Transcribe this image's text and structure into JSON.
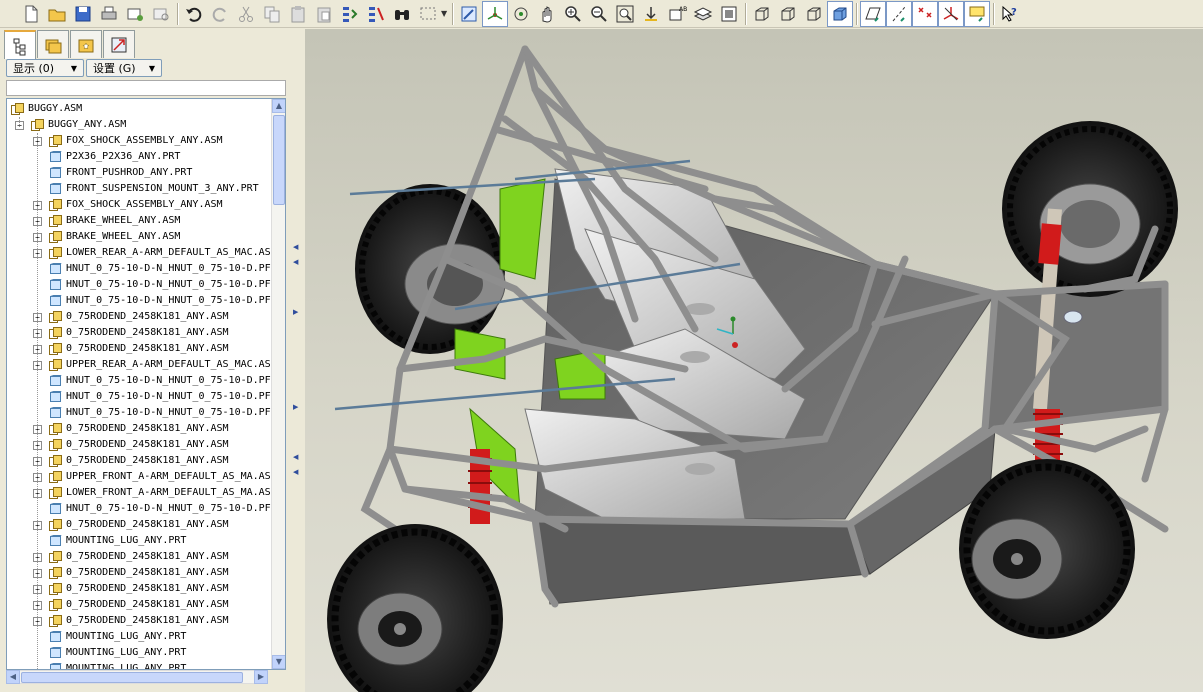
{
  "panel": {
    "show_button": "显示 (0)",
    "settings_button": "设置 (G)"
  },
  "toolbar": {
    "icons": [
      "new-file",
      "open",
      "save",
      "print",
      "send-mail",
      "close-window",
      "undo",
      "redo",
      "cut",
      "copy",
      "paste",
      "paste-special",
      "regenerate",
      "regenerate-manager",
      "find",
      "select-box",
      "repaint",
      "spin-center",
      "orient",
      "pan",
      "zoom-in",
      "zoom-out",
      "refit",
      "view-manager",
      "named-views",
      "layers",
      "model-display",
      "wireframe",
      "hidden-line",
      "no-hidden",
      "shading",
      "datum-planes",
      "datum-axes",
      "datum-points",
      "coordinate-systems",
      "annotations",
      "whats-this"
    ]
  },
  "tree": {
    "items": [
      {
        "label": "BUGGY.ASM",
        "level": 0,
        "type": "asm",
        "expander": "none"
      },
      {
        "label": "BUGGY_ANY.ASM",
        "level": 1,
        "type": "asm",
        "expander": "minus"
      },
      {
        "label": "FOX_SHOCK_ASSEMBLY_ANY.ASM",
        "level": 2,
        "type": "asm",
        "expander": "plus"
      },
      {
        "label": "P2X36_P2X36_ANY.PRT",
        "level": 2,
        "type": "prt",
        "expander": "none"
      },
      {
        "label": "FRONT_PUSHROD_ANY.PRT",
        "level": 2,
        "type": "prt",
        "expander": "none"
      },
      {
        "label": "FRONT_SUSPENSION_MOUNT_3_ANY.PRT",
        "level": 2,
        "type": "prt",
        "expander": "none"
      },
      {
        "label": "FOX_SHOCK_ASSEMBLY_ANY.ASM",
        "level": 2,
        "type": "asm",
        "expander": "plus"
      },
      {
        "label": "BRAKE_WHEEL_ANY.ASM",
        "level": 2,
        "type": "asm",
        "expander": "plus"
      },
      {
        "label": "BRAKE_WHEEL_ANY.ASM",
        "level": 2,
        "type": "asm",
        "expander": "plus"
      },
      {
        "label": "LOWER_REAR_A-ARM_DEFAULT_AS_MAC.AS",
        "level": 2,
        "type": "asm",
        "expander": "plus"
      },
      {
        "label": "HNUT_0_75-10-D-N_HNUT_0_75-10-D.PF",
        "level": 2,
        "type": "prt",
        "expander": "none"
      },
      {
        "label": "HNUT_0_75-10-D-N_HNUT_0_75-10-D.PF",
        "level": 2,
        "type": "prt",
        "expander": "none"
      },
      {
        "label": "HNUT_0_75-10-D-N_HNUT_0_75-10-D.PF",
        "level": 2,
        "type": "prt",
        "expander": "none"
      },
      {
        "label": "0_75RODEND_2458K181_ANY.ASM",
        "level": 2,
        "type": "asm",
        "expander": "plus"
      },
      {
        "label": "0_75RODEND_2458K181_ANY.ASM",
        "level": 2,
        "type": "asm",
        "expander": "plus"
      },
      {
        "label": "0_75RODEND_2458K181_ANY.ASM",
        "level": 2,
        "type": "asm",
        "expander": "plus"
      },
      {
        "label": "UPPER_REAR_A-ARM_DEFAULT_AS_MAC.AS",
        "level": 2,
        "type": "asm",
        "expander": "plus"
      },
      {
        "label": "HNUT_0_75-10-D-N_HNUT_0_75-10-D.PF",
        "level": 2,
        "type": "prt",
        "expander": "none"
      },
      {
        "label": "HNUT_0_75-10-D-N_HNUT_0_75-10-D.PF",
        "level": 2,
        "type": "prt",
        "expander": "none"
      },
      {
        "label": "HNUT_0_75-10-D-N_HNUT_0_75-10-D.PF",
        "level": 2,
        "type": "prt",
        "expander": "none"
      },
      {
        "label": "0_75RODEND_2458K181_ANY.ASM",
        "level": 2,
        "type": "asm",
        "expander": "plus"
      },
      {
        "label": "0_75RODEND_2458K181_ANY.ASM",
        "level": 2,
        "type": "asm",
        "expander": "plus"
      },
      {
        "label": "0_75RODEND_2458K181_ANY.ASM",
        "level": 2,
        "type": "asm",
        "expander": "plus"
      },
      {
        "label": "UPPER_FRONT_A-ARM_DEFAULT_AS_MA.AS",
        "level": 2,
        "type": "asm",
        "expander": "plus"
      },
      {
        "label": "LOWER_FRONT_A-ARM_DEFAULT_AS_MA.AS",
        "level": 2,
        "type": "asm",
        "expander": "plus"
      },
      {
        "label": "HNUT_0_75-10-D-N_HNUT_0_75-10-D.PF",
        "level": 2,
        "type": "prt",
        "expander": "none"
      },
      {
        "label": "0_75RODEND_2458K181_ANY.ASM",
        "level": 2,
        "type": "asm",
        "expander": "plus"
      },
      {
        "label": "MOUNTING_LUG_ANY.PRT",
        "level": 2,
        "type": "prt",
        "expander": "none"
      },
      {
        "label": "0_75RODEND_2458K181_ANY.ASM",
        "level": 2,
        "type": "asm",
        "expander": "plus"
      },
      {
        "label": "0_75RODEND_2458K181_ANY.ASM",
        "level": 2,
        "type": "asm",
        "expander": "plus"
      },
      {
        "label": "0_75RODEND_2458K181_ANY.ASM",
        "level": 2,
        "type": "asm",
        "expander": "plus"
      },
      {
        "label": "0_75RODEND_2458K181_ANY.ASM",
        "level": 2,
        "type": "asm",
        "expander": "plus"
      },
      {
        "label": "0_75RODEND_2458K181_ANY.ASM",
        "level": 2,
        "type": "asm",
        "expander": "plus"
      },
      {
        "label": "MOUNTING_LUG_ANY.PRT",
        "level": 2,
        "type": "prt",
        "expander": "none"
      },
      {
        "label": "MOUNTING_LUG_ANY.PRT",
        "level": 2,
        "type": "prt",
        "expander": "none"
      },
      {
        "label": "MOUNTING_LUG_ANY.PRT",
        "level": 2,
        "type": "prt",
        "expander": "none"
      }
    ]
  },
  "colors": {
    "frame_tube": "#8e8e8e",
    "accent_green": "#7fd31f",
    "shock_red": "#d11b1b",
    "panel_grey": "#6b6b6b",
    "seat_light": "#d9d9d9",
    "tire_dark": "#1e1e1e",
    "viewport_bg": "#d6d5c8"
  }
}
